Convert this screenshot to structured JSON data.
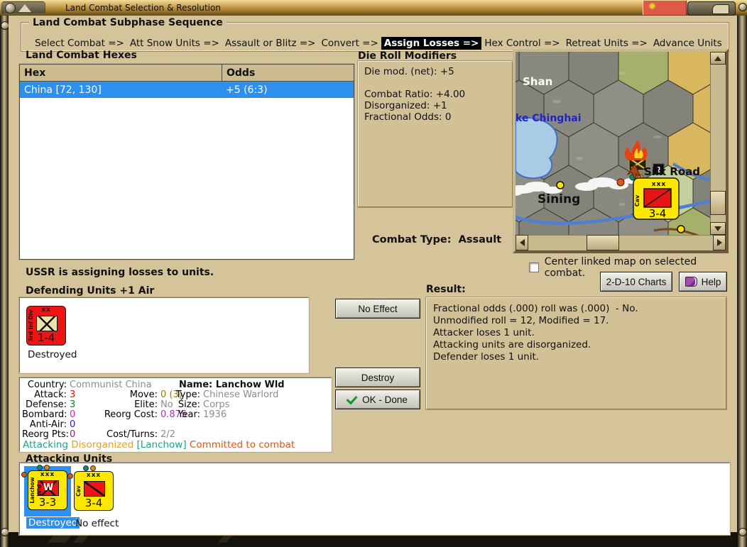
{
  "title_bar": {
    "title": "Land Combat Selection & Resolution"
  },
  "colors": {
    "highlight_blue": "#2d8fee",
    "counter_yellow": "#ffe800",
    "counter_red": "#ee1414",
    "page_tan": "#d5c39a",
    "titlebar_gold": "#c9a452",
    "flag_red": "#dd5a48"
  },
  "subphase": {
    "title": "Land Combat Subphase Sequence",
    "phases": [
      {
        "label": "Select Combat =>",
        "active": false
      },
      {
        "label": "Att Snow Units =>",
        "active": false
      },
      {
        "label": "Assault or Blitz =>",
        "active": false
      },
      {
        "label": "Convert =>",
        "active": false
      },
      {
        "label": "Assign Losses =>",
        "active": true
      },
      {
        "label": "Hex Control =>",
        "active": false
      },
      {
        "label": "Retreat Units =>",
        "active": false
      },
      {
        "label": "Advance Units",
        "active": false
      }
    ]
  },
  "hex_table": {
    "title": "Land Combat Hexes",
    "columns": [
      "Hex",
      "Odds"
    ],
    "rows": [
      {
        "hex": "China [72, 130]",
        "odds": "+5 (6:3)",
        "selected": true
      }
    ]
  },
  "die_modifiers": {
    "title": "Die Roll Modifiers",
    "line1": "Die mod. (net): +5",
    "line2": "Combat Ratio: +4.00",
    "line3": "Disorganized: +1",
    "line4": "Fractional Odds: 0"
  },
  "combat_type": {
    "label": "Combat Type:",
    "value": "Assault"
  },
  "map": {
    "labels": {
      "region": "Shan",
      "lake": "ke Chinghai",
      "city": "Sining",
      "road": "Silk Road"
    },
    "stack_badge": "2",
    "unit": {
      "size": "xxx",
      "side": "Cav",
      "strength": "3-4"
    }
  },
  "map_option": {
    "label": "Center linked map on selected combat.",
    "checked": false
  },
  "charts_button": "2-D-10 Charts",
  "help_button": "Help",
  "status_line": "USSR is assigning losses to units.",
  "defending": {
    "title": "Defending Units +1 Air",
    "unit": {
      "size": "xx",
      "side": "3rd Inf Div",
      "strength": "1-4",
      "state": "Destroyed"
    }
  },
  "action_buttons": {
    "no_effect": "No Effect",
    "destroy": "Destroy",
    "ok_done": "OK - Done"
  },
  "unit_info": {
    "country_label": "Country:",
    "country": "Communist China",
    "attack_label": "Attack:",
    "attack": "3",
    "defense_label": "Defense:",
    "defense": "3",
    "bombard_label": "Bombard:",
    "bombard": "0",
    "antiair_label": "Anti-Air:",
    "antiair": "0",
    "reorgpts_label": "Reorg Pts:",
    "reorgpts": "0",
    "move_label": "Move:",
    "move": "0 (3)",
    "elite_label": "Elite:",
    "elite": "No",
    "reorgcost_label": "Reorg Cost:",
    "reorgcost": "0.875",
    "costturns_label": "Cost/Turns:",
    "costturns": "2/2",
    "name_label": "Name:",
    "name": "Lanchow Wld",
    "type_label": "Type:",
    "type": "Chinese Warlord",
    "size_label": "Size:",
    "size": "Corps",
    "year_label": "Year:",
    "year": "1936",
    "status": {
      "s1": "Attacking",
      "s2": "Disorganized",
      "s3": "[Lanchow]",
      "s4": "Committed to combat"
    }
  },
  "result": {
    "title": "Result:",
    "line1": "Fractional odds (.000) roll was (.000)  - No.",
    "line2": "Unmodified roll = 12, Modified = 17.",
    "line3": "Attacker loses 1 unit.",
    "line4": "Attacking units are disorganized.",
    "line5": "Defender loses 1 unit."
  },
  "attacking": {
    "title": "Attacking Units",
    "unit1": {
      "size": "xxx",
      "side": "Lanchow Wld",
      "symbol_letter": "W",
      "strength": "3-3",
      "state": "Destroyed",
      "selected": true
    },
    "unit2": {
      "size": "xxx",
      "side": "Cav",
      "strength": "3-4",
      "state": "No effect",
      "selected": false
    }
  }
}
